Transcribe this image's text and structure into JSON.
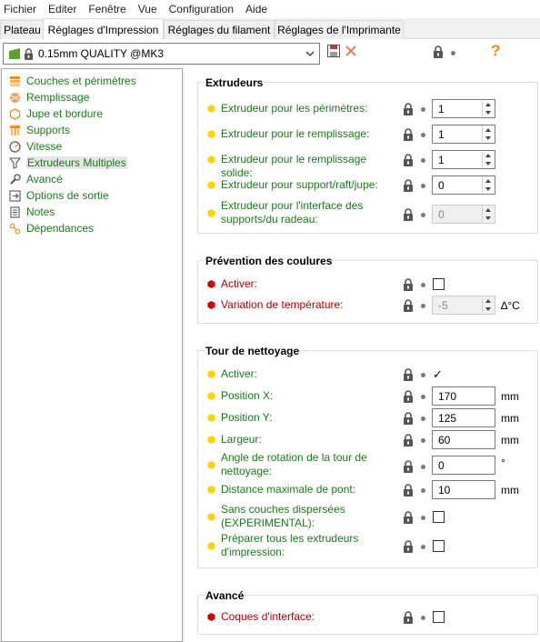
{
  "menu": [
    "Fichier",
    "Editer",
    "Fenêtre",
    "Vue",
    "Configuration",
    "Aide"
  ],
  "tabs": [
    "Plateau",
    "Réglages d'Impression",
    "Réglages du filament",
    "Réglages de l'Imprimante"
  ],
  "preset": {
    "name": "0.15mm QUALITY @MK3"
  },
  "sidebar": {
    "items": [
      {
        "label": "Couches et périmètres",
        "icon": "layers-icon"
      },
      {
        "label": "Remplissage",
        "icon": "infill-icon"
      },
      {
        "label": "Jupe et bordure",
        "icon": "skirt-icon"
      },
      {
        "label": "Supports",
        "icon": "support-icon"
      },
      {
        "label": "Vitesse",
        "icon": "speed-icon"
      },
      {
        "label": "Extrudeurs Multiples",
        "icon": "funnel-icon"
      },
      {
        "label": "Avancé",
        "icon": "wrench-icon"
      },
      {
        "label": "Options de sortie",
        "icon": "output-icon"
      },
      {
        "label": "Notes",
        "icon": "note-icon"
      },
      {
        "label": "Dépendances",
        "icon": "dependencies-icon"
      }
    ]
  },
  "groups": {
    "extruders": {
      "title": "Extrudeurs",
      "rows": [
        {
          "label": "Extrudeur pour les périmètres:",
          "value": "1"
        },
        {
          "label": "Extrudeur pour le remplissage:",
          "value": "1"
        },
        {
          "label": "Extrudeur pour le remplissage solide:",
          "value": "1"
        },
        {
          "label": "Extrudeur pour support/raft/jupe:",
          "value": "0"
        },
        {
          "label_line1": "Extrudeur pour l'interface des",
          "label_line2": "supports/du radeau:",
          "value": "0"
        }
      ]
    },
    "ooze": {
      "title": "Prévention des coulures",
      "enable_label": "Activer:",
      "temp_label": "Variation de température:",
      "temp_value": "-5",
      "temp_unit": "∆°C"
    },
    "wipe": {
      "title": "Tour de nettoyage",
      "enable_label": "Activer:",
      "enable_mark": "✓",
      "posx_label": "Position X:",
      "posx_value": "170",
      "posx_unit": "mm",
      "posy_label": "Position Y:",
      "posy_value": "125",
      "posy_unit": "mm",
      "width_label": "Largeur:",
      "width_value": "60",
      "width_unit": "mm",
      "angle_label1": "Angle de rotation de la tour de",
      "angle_label2": "nettoyage:",
      "angle_value": "0",
      "angle_unit": "°",
      "bridge_label": "Distance maximale de pont:",
      "bridge_value": "10",
      "bridge_unit": "mm",
      "sparse_label1": "Sans couches dispersées",
      "sparse_label2": "(EXPERIMENTAL):",
      "prime_label1": "Préparer tous les extrudeurs",
      "prime_label2": "d'impression:"
    },
    "advanced": {
      "title": "Avancé",
      "interface_label": "Coques d'interface:"
    }
  },
  "colors": {
    "green_text": "#1a7a1a",
    "red_text": "#b00000",
    "yellow_bullet": "#ffd200",
    "red_bullet": "#cc0000",
    "orange": "#ff8a00"
  }
}
